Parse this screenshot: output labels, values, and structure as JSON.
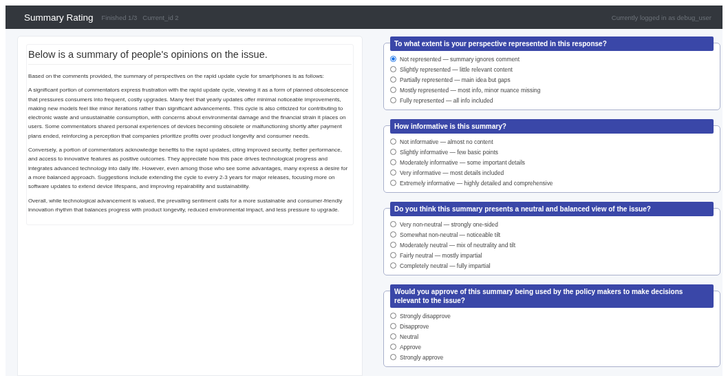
{
  "navbar": {
    "title": "Summary Rating",
    "progress": "Finished 1/3",
    "current_id": "Current_id 2",
    "user": "Currently logged in as debug_user"
  },
  "summary": {
    "heading": "Below is a summary of people's opinions on the issue.",
    "paragraphs": [
      "Based on the comments provided, the summary of perspectives on the rapid update cycle for smartphones is as follows:",
      "A significant portion of commentators express frustration with the rapid update cycle, viewing it as a form of planned obsolescence that pressures consumers into frequent, costly upgrades. Many feel that yearly updates offer minimal noticeable improvements, making new models feel like minor iterations rather than significant advancements. This cycle is also criticized for contributing to electronic waste and unsustainable consumption, with concerns about environmental damage and the financial strain it places on users. Some commentators shared personal experiences of devices becoming obsolete or malfunctioning shortly after payment plans ended, reinforcing a perception that companies prioritize profits over product longevity and consumer needs.",
      "Conversely, a portion of commentators acknowledge benefits to the rapid updates, citing improved security, better performance, and access to innovative features as positive outcomes. They appreciate how this pace drives technological progress and integrates advanced technology into daily life. However, even among those who see some advantages, many express a desire for a more balanced approach. Suggestions include extending the cycle to every 2-3 years for major releases, focusing more on software updates to extend device lifespans, and improving repairability and sustainability.",
      "Overall, while technological advancement is valued, the prevailing sentiment calls for a more sustainable and consumer-friendly innovation rhythm that balances progress with product longevity, reduced environmental impact, and less pressure to upgrade."
    ]
  },
  "questions": [
    {
      "question": "To what extent is your perspective represented in this response?",
      "options": [
        {
          "label": "Not represented — summary ignores comment",
          "selected": true
        },
        {
          "label": "Slightly represented — little relevant content",
          "selected": false
        },
        {
          "label": "Partially represented — main idea but gaps",
          "selected": false
        },
        {
          "label": "Mostly represented — most info, minor nuance missing",
          "selected": false
        },
        {
          "label": "Fully represented — all info included",
          "selected": false
        }
      ]
    },
    {
      "question": "How informative is this summary?",
      "options": [
        {
          "label": "Not informative — almost no content",
          "selected": false
        },
        {
          "label": "Slightly informative — few basic points",
          "selected": false
        },
        {
          "label": "Moderately informative — some important details",
          "selected": false
        },
        {
          "label": "Very informative — most details included",
          "selected": false
        },
        {
          "label": "Extremely informative — highly detailed and comprehensive",
          "selected": false
        }
      ]
    },
    {
      "question": "Do you think this summary presents a neutral and balanced view of the issue?",
      "options": [
        {
          "label": "Very non-neutral — strongly one-sided",
          "selected": false
        },
        {
          "label": "Somewhat non-neutral — noticeable tilt",
          "selected": false
        },
        {
          "label": "Moderately neutral — mix of neutrality and tilt",
          "selected": false
        },
        {
          "label": "Fairly neutral — mostly impartial",
          "selected": false
        },
        {
          "label": "Completely neutral — fully impartial",
          "selected": false
        }
      ]
    },
    {
      "question": "Would you approve of this summary being used by the policy makers to make decisions relevant to the issue?",
      "options": [
        {
          "label": "Strongly disapprove",
          "selected": false
        },
        {
          "label": "Disapprove",
          "selected": false
        },
        {
          "label": "Neutral",
          "selected": false
        },
        {
          "label": "Approve",
          "selected": false
        },
        {
          "label": "Strongly approve",
          "selected": false
        }
      ]
    }
  ]
}
